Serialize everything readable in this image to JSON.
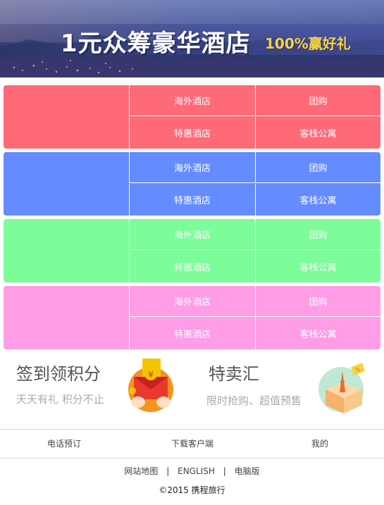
{
  "banner": {
    "title": "1元众筹豪华酒店",
    "subtitle": "100%赢好礼"
  },
  "categories": [
    {
      "color": "#ff6a78",
      "items": [
        "海外酒店",
        "团购",
        "特惠酒店",
        "客栈公寓"
      ]
    },
    {
      "color": "#648cff",
      "items": [
        "海外酒店",
        "团购",
        "特惠酒店",
        "客栈公寓"
      ]
    },
    {
      "color": "#7dfc9a",
      "items": [
        "海外酒店",
        "团购",
        "特惠酒店",
        "客栈公寓"
      ]
    },
    {
      "color": "#ff9de6",
      "items": [
        "海外酒店",
        "团购",
        "特惠酒店",
        "客栈公寓"
      ]
    }
  ],
  "promo": {
    "signin": {
      "title": "签到领积分",
      "subtitle": "天天有礼 积分不止",
      "icon": "red-envelope-icon"
    },
    "sale": {
      "title": "特卖汇",
      "subtitle": "限时抢购、超值预售",
      "icon": "travel-box-icon"
    }
  },
  "bottom_nav": [
    "电话预订",
    "下载客户端",
    "我的"
  ],
  "footer": {
    "links": [
      "网站地图",
      "ENGLISH",
      "电脑版"
    ],
    "separator": "|",
    "copyright": "©2015 携程旅行"
  }
}
